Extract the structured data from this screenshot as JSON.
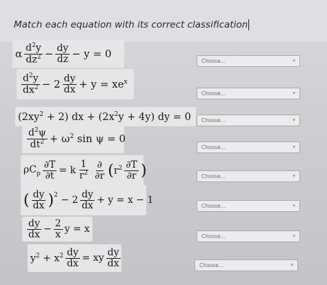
{
  "question": {
    "prompt": "Match each equation with its correct classification"
  },
  "select_placeholder": "Choose...",
  "equations": [
    "α d²y/dz² − dy/dz − y = 0",
    "d²y/dx² − 2 dy/dx + y = xeˣ",
    "(2xy² + 2) dx + (2x²y + 4y) dy = 0",
    "d²ψ/dt² + ω² sin ψ = 0",
    "ρC_p ∂T/∂t = k (1/r²) ∂/∂r (r² ∂T/∂r)",
    "(dy/dx)² − 2 dy/dx + y = x − 1",
    "dy/dx − (2/x) y = x",
    "y² + x² dy/dx = xy dy/dx"
  ]
}
